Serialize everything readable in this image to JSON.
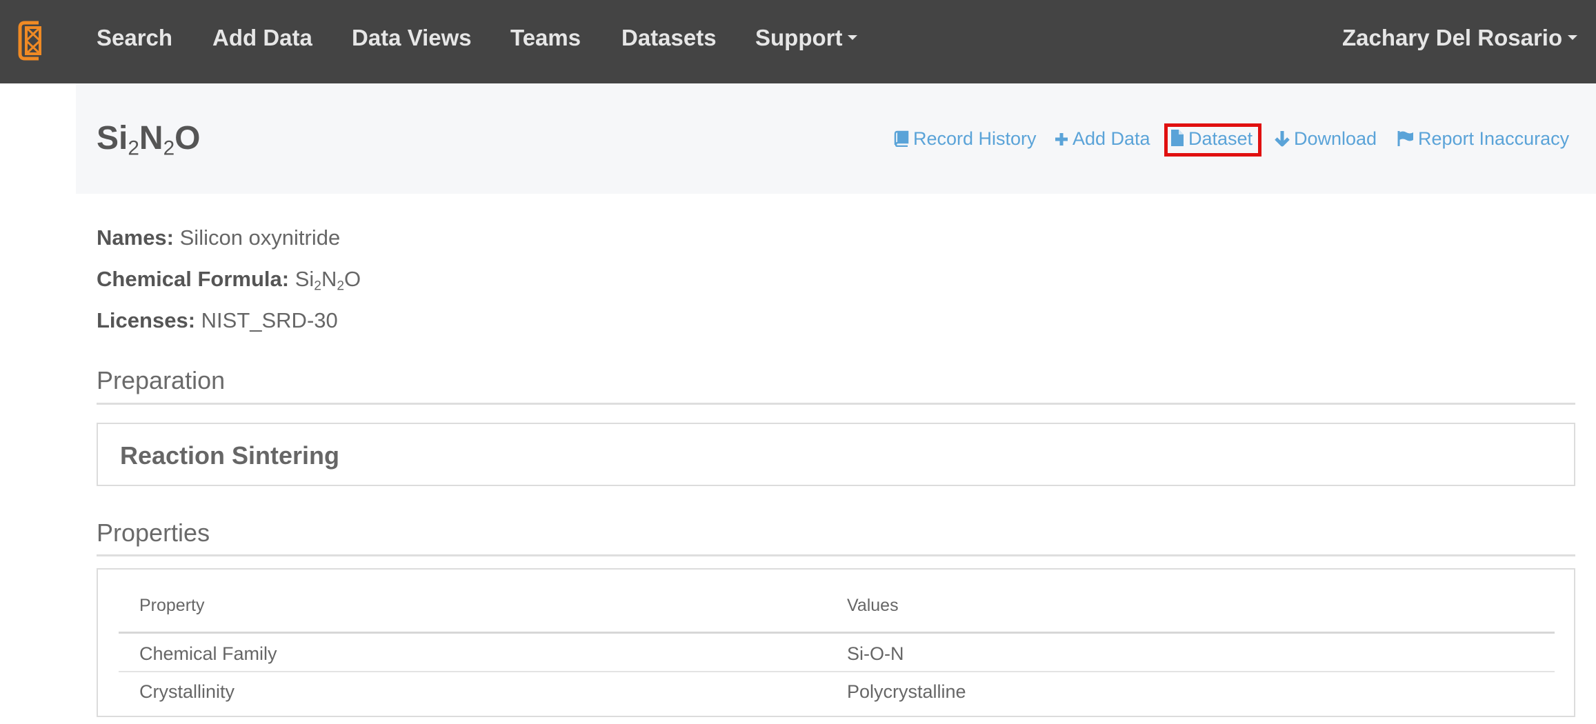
{
  "nav": {
    "items": [
      "Search",
      "Add Data",
      "Data Views",
      "Teams",
      "Datasets",
      "Support"
    ],
    "user": "Zachary Del Rosario"
  },
  "record": {
    "formula": {
      "parts": [
        [
          "Si",
          "2"
        ],
        [
          "N",
          "2"
        ],
        [
          "O",
          ""
        ]
      ]
    }
  },
  "actions": [
    {
      "label": "Record History",
      "icon": "book-icon"
    },
    {
      "label": "Add Data",
      "icon": "plus-icon"
    },
    {
      "label": "Dataset",
      "icon": "file-icon",
      "highlighted": true,
      "highlight_color": "#e01010"
    },
    {
      "label": "Download",
      "icon": "arrow-down-icon"
    },
    {
      "label": "Report Inaccuracy",
      "icon": "flag-icon"
    }
  ],
  "details": {
    "names_label": "Names:",
    "names_value": "Silicon oxynitride",
    "formula_label": "Chemical Formula:",
    "licenses_label": "Licenses:",
    "licenses_value": "NIST_SRD-30"
  },
  "preparation": {
    "heading": "Preparation",
    "method": "Reaction Sintering"
  },
  "properties": {
    "heading": "Properties",
    "columns": [
      "Property",
      "Values"
    ],
    "rows": [
      [
        "Chemical Family",
        "Si-O-N"
      ],
      [
        "Crystallinity",
        "Polycrystalline"
      ]
    ]
  },
  "colors": {
    "navbar": "#444444",
    "link": "#5aa3d8",
    "logo": "#f08a24",
    "highlight": "#e01010"
  }
}
